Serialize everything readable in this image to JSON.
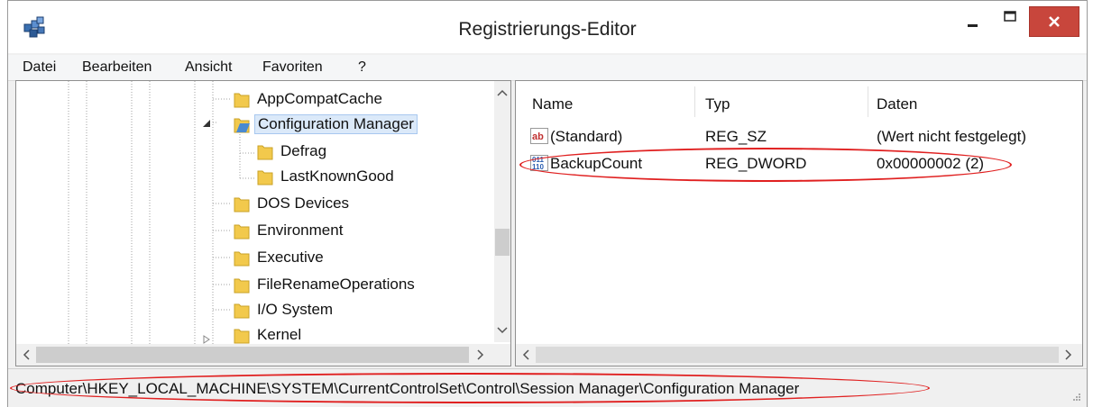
{
  "window": {
    "title": "Registrierungs-Editor"
  },
  "menu": [
    "Datei",
    "Bearbeiten",
    "Ansicht",
    "Favoriten",
    "?"
  ],
  "tree": {
    "items": [
      {
        "label": "AppCompatCache"
      },
      {
        "label": "Configuration Manager",
        "selected": true,
        "expanded": true
      },
      {
        "label": "Defrag"
      },
      {
        "label": "LastKnownGood"
      },
      {
        "label": "DOS Devices"
      },
      {
        "label": "Environment"
      },
      {
        "label": "Executive"
      },
      {
        "label": "FileRenameOperations"
      },
      {
        "label": "I/O System"
      },
      {
        "label": "Kernel"
      }
    ]
  },
  "list": {
    "columns": [
      "Name",
      "Typ",
      "Daten"
    ],
    "rows": [
      {
        "icon": "string-value-icon",
        "name": "(Standard)",
        "type": "REG_SZ",
        "data": "(Wert nicht festgelegt)"
      },
      {
        "icon": "binary-value-icon",
        "name": "BackupCount",
        "type": "REG_DWORD",
        "data": "0x00000002 (2)"
      }
    ]
  },
  "status": {
    "path": "Computer\\HKEY_LOCAL_MACHINE\\SYSTEM\\CurrentControlSet\\Control\\Session Manager\\Configuration Manager"
  },
  "colors": {
    "highlight_ellipse": "#e02020",
    "close_button": "#c8463c",
    "selection": "#dbe9f9"
  }
}
